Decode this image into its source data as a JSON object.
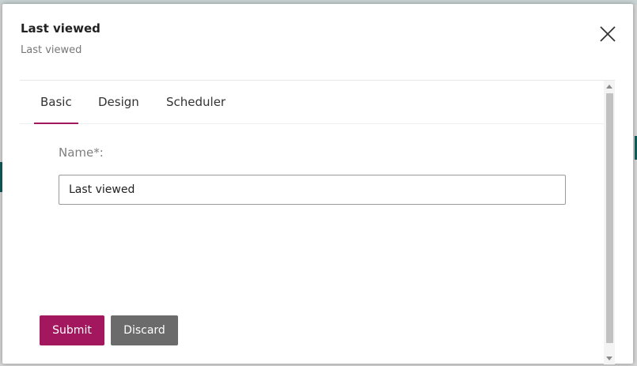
{
  "dialog": {
    "title": "Last viewed",
    "subtitle": "Last viewed",
    "close_icon": "close-icon"
  },
  "tabs": [
    {
      "label": "Basic",
      "active": true
    },
    {
      "label": "Design",
      "active": false
    },
    {
      "label": "Scheduler",
      "active": false
    }
  ],
  "form": {
    "name_label": "Name*:",
    "name_value": "Last viewed"
  },
  "actions": {
    "submit_label": "Submit",
    "discard_label": "Discard"
  },
  "colors": {
    "accent": "#a3175f",
    "discard": "#6b6b6b"
  }
}
